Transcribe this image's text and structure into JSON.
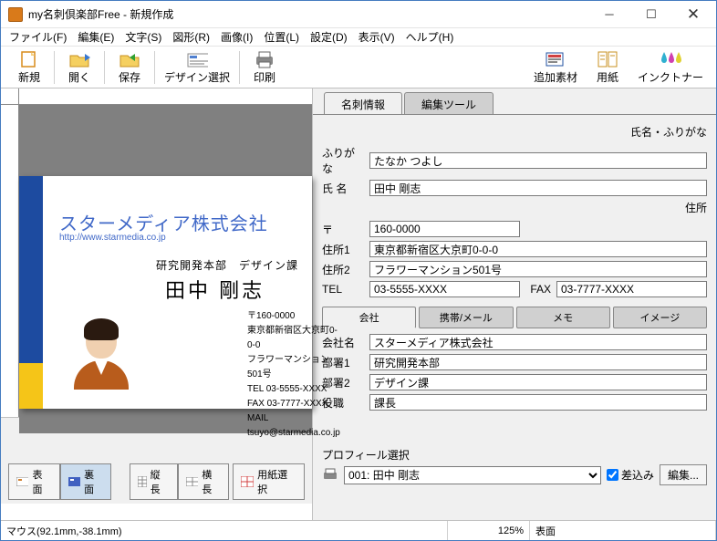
{
  "window": {
    "title": "my名刺倶楽部Free - 新規作成"
  },
  "menu": {
    "file": "ファイル(F)",
    "edit": "編集(E)",
    "text": "文字(S)",
    "shape": "図形(R)",
    "image": "画像(I)",
    "position": "位置(L)",
    "settings": "設定(D)",
    "view": "表示(V)",
    "help": "ヘルプ(H)"
  },
  "toolbar": {
    "new": "新規",
    "open": "開く",
    "save": "保存",
    "design": "デザイン選択",
    "print": "印刷",
    "addmat": "追加素材",
    "paper": "用紙",
    "ink": "インクトナー"
  },
  "bottomtabs": {
    "front": "表面",
    "back": "裏面",
    "tall": "縦長",
    "wide": "横長",
    "papersel": "用紙選択"
  },
  "righttabs": {
    "info": "名刺情報",
    "tools": "編集ツール"
  },
  "sections": {
    "namefuri": "氏名・ふりがな",
    "address": "住所"
  },
  "fields": {
    "furigana_label": "ふりがな",
    "furigana": "たなか つよし",
    "name_label": "氏 名",
    "name": "田中 剛志",
    "zip_label": "〒",
    "zip": "160-0000",
    "addr1_label": "住所1",
    "addr1": "東京都新宿区大京町0-0-0",
    "addr2_label": "住所2",
    "addr2": "フラワーマンション501号",
    "tel_label": "TEL",
    "tel": "03-5555-XXXX",
    "fax_label": "FAX",
    "fax": "03-7777-XXXX"
  },
  "subtabs": {
    "company": "会社",
    "mobile": "携帯/メール",
    "memo": "メモ",
    "image": "イメージ"
  },
  "company": {
    "name_label": "会社名",
    "name": "スターメディア株式会社",
    "dept1_label": "部署1",
    "dept1": "研究開発本部",
    "dept2_label": "部署2",
    "dept2": "デザイン課",
    "title_label": "役職",
    "title": "課長"
  },
  "profile": {
    "label": "プロフィール選択",
    "selected": "001: 田中 剛志",
    "merge": "差込み",
    "edit": "編集..."
  },
  "card": {
    "company": "スターメディア株式会社",
    "url": "http://www.starmedia.co.jp",
    "dept": "研究開発本部　デザイン課",
    "name": "田中 剛志",
    "zip": "〒160-0000",
    "addr1": "東京都新宿区大京町0-0-0",
    "addr2": "フラワーマンション501号",
    "tel": "TEL 03-5555-XXXX",
    "fax": "FAX 03-7777-XXXX",
    "mail": "MAIL tsuyo@starmedia.co.jp"
  },
  "status": {
    "mouse": "マウス(92.1mm,-38.1mm)",
    "zoom": "125%",
    "face": "表面"
  }
}
